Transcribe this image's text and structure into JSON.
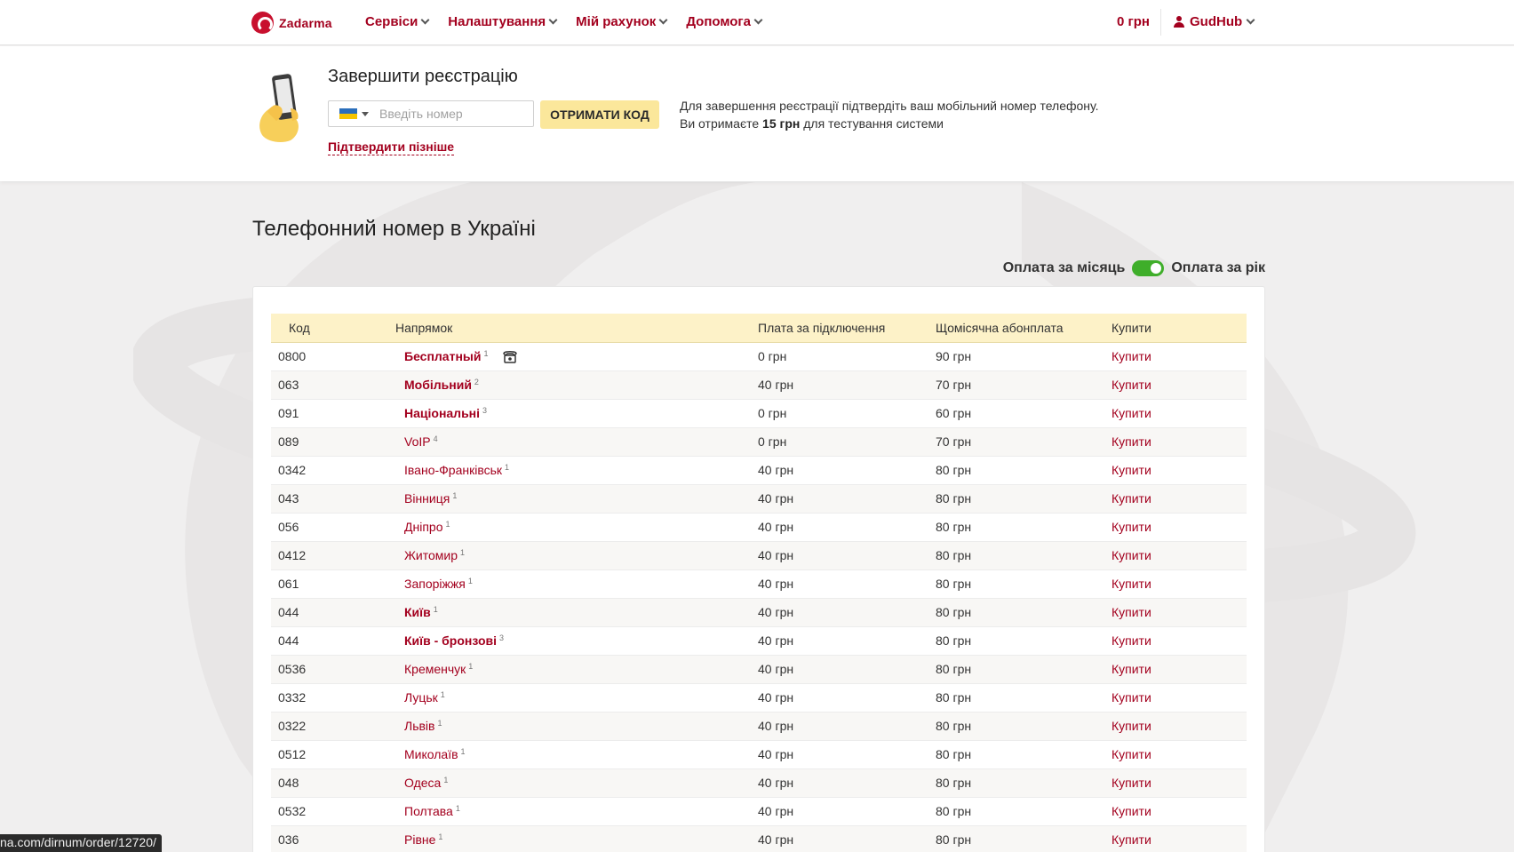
{
  "header": {
    "logo_text": "Zadarma",
    "nav": [
      {
        "label": "Сервіси"
      },
      {
        "label": "Налаштування"
      },
      {
        "label": "Мій рахунок"
      },
      {
        "label": "Допомога"
      }
    ],
    "balance": "0 грн",
    "user": "GudHub"
  },
  "registration": {
    "title": "Завершити реєстрацію",
    "phone_placeholder": "Введіть номер",
    "get_code_label": "ОТРИМАТИ КОД",
    "confirm_later_label": "Підтвердити пізніше",
    "note_line1": "Для завершення реєстрації підтвердіть ваш мобільний номер телефону.",
    "note_line2_prefix": "Ви отримаєте ",
    "note_line2_amount": "15 грн",
    "note_line2_suffix": " для тестування системи"
  },
  "main": {
    "title": "Телефонний номер в Україні",
    "billing_monthly": "Оплата за місяць",
    "billing_yearly": "Оплата за рік",
    "billing_yearly_on": true
  },
  "table": {
    "headers": {
      "code": "Код",
      "direction": "Напрямок",
      "connection": "Плата за підключення",
      "monthly": "Щомісячна абонплата",
      "buy": "Купити"
    },
    "rows": [
      {
        "code": "0800",
        "direction": "Бесплатный",
        "note": "1",
        "bold": true,
        "tollfree": true,
        "connection": "0 грн",
        "monthly": "90 грн",
        "buy": "Купити"
      },
      {
        "code": "063",
        "direction": "Мобільний",
        "note": "2",
        "bold": true,
        "connection": "40 грн",
        "monthly": "70 грн",
        "buy": "Купити"
      },
      {
        "code": "091",
        "direction": "Національні",
        "note": "3",
        "bold": true,
        "connection": "0 грн",
        "monthly": "60 грн",
        "buy": "Купити"
      },
      {
        "code": "089",
        "direction": "VoIP",
        "note": "4",
        "bold": false,
        "connection": "0 грн",
        "monthly": "70 грн",
        "buy": "Купити"
      },
      {
        "code": "0342",
        "direction": "Івано-Франківськ",
        "note": "1",
        "bold": false,
        "connection": "40 грн",
        "monthly": "80 грн",
        "buy": "Купити"
      },
      {
        "code": "043",
        "direction": "Вінниця",
        "note": "1",
        "bold": false,
        "connection": "40 грн",
        "monthly": "80 грн",
        "buy": "Купити"
      },
      {
        "code": "056",
        "direction": "Дніпро",
        "note": "1",
        "bold": false,
        "connection": "40 грн",
        "monthly": "80 грн",
        "buy": "Купити"
      },
      {
        "code": "0412",
        "direction": "Житомир",
        "note": "1",
        "bold": false,
        "connection": "40 грн",
        "monthly": "80 грн",
        "buy": "Купити"
      },
      {
        "code": "061",
        "direction": "Запоріжжя",
        "note": "1",
        "bold": false,
        "connection": "40 грн",
        "monthly": "80 грн",
        "buy": "Купити"
      },
      {
        "code": "044",
        "direction": "Київ",
        "note": "1",
        "bold": true,
        "connection": "40 грн",
        "monthly": "80 грн",
        "buy": "Купити"
      },
      {
        "code": "044",
        "direction": "Київ - бронзові",
        "note": "3",
        "bold": true,
        "connection": "40 грн",
        "monthly": "80 грн",
        "buy": "Купити"
      },
      {
        "code": "0536",
        "direction": "Кременчук",
        "note": "1",
        "bold": false,
        "connection": "40 грн",
        "monthly": "80 грн",
        "buy": "Купити"
      },
      {
        "code": "0332",
        "direction": "Луцьк",
        "note": "1",
        "bold": false,
        "connection": "40 грн",
        "monthly": "80 грн",
        "buy": "Купити"
      },
      {
        "code": "0322",
        "direction": "Львів",
        "note": "1",
        "bold": false,
        "connection": "40 грн",
        "monthly": "80 грн",
        "buy": "Купити"
      },
      {
        "code": "0512",
        "direction": "Миколаїв",
        "note": "1",
        "bold": false,
        "connection": "40 грн",
        "monthly": "80 грн",
        "buy": "Купити"
      },
      {
        "code": "048",
        "direction": "Одеса",
        "note": "1",
        "bold": false,
        "connection": "40 грн",
        "monthly": "80 грн",
        "buy": "Купити"
      },
      {
        "code": "0532",
        "direction": "Полтава",
        "note": "1",
        "bold": false,
        "connection": "40 грн",
        "monthly": "80 грн",
        "buy": "Купити"
      },
      {
        "code": "036",
        "direction": "Рівне",
        "note": "1",
        "bold": false,
        "connection": "40 грн",
        "monthly": "80 грн",
        "buy": "Купити"
      }
    ]
  },
  "status_url": "na.com/dirnum/order/12720/",
  "colors": {
    "brand": "#a3001e",
    "toggle_on": "#3fae2a",
    "table_header_bg": "#fdf2c8",
    "button_bg": "#fbe79b"
  }
}
